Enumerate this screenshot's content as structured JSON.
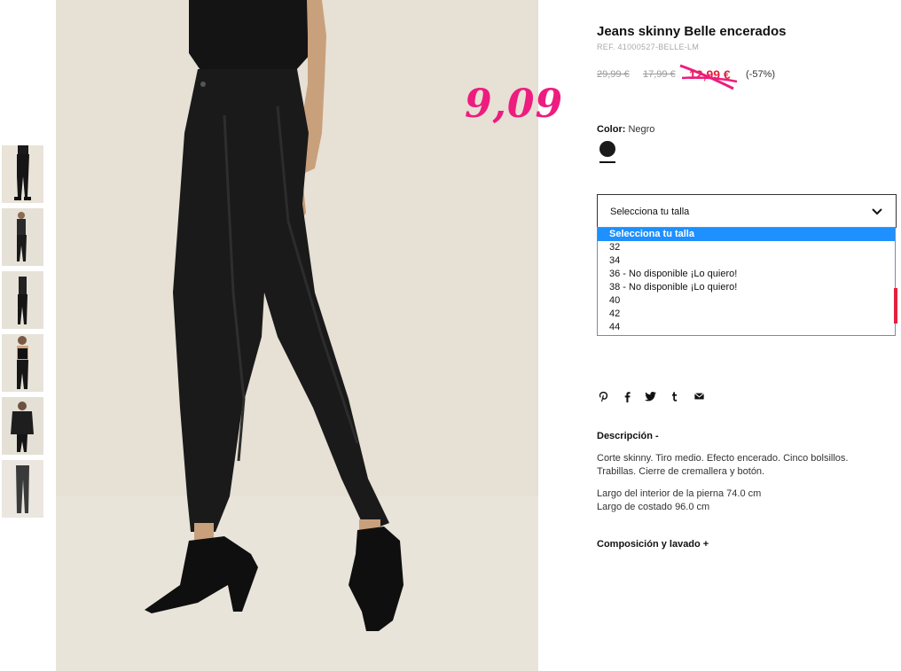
{
  "product": {
    "title": "Jeans skinny Belle encerados",
    "ref": "REF. 41000527-BELLE-LM",
    "prices": {
      "original": "29,99 €",
      "first_markdown": "17,99 €",
      "current": "12,99 €",
      "discount": "(-57%)"
    },
    "overlay_price": "9,09",
    "color": {
      "label": "Color:",
      "value": "Negro",
      "swatch_hex": "#1a1a1a"
    }
  },
  "size_select": {
    "placeholder": "Selecciona tu talla",
    "options": [
      "Selecciona tu talla",
      "32",
      "34",
      "36 - No disponible ¡Lo quiero!",
      "38 - No disponible ¡Lo quiero!",
      "40",
      "42",
      "44"
    ],
    "selected_index": 0
  },
  "share_icons": [
    "pinterest-icon",
    "facebook-icon",
    "twitter-icon",
    "tumblr-icon",
    "email-icon"
  ],
  "description": {
    "heading": "Descripción -",
    "paragraph1": "Corte skinny. Tiro medio. Efecto encerado. Cinco bolsillos. Trabillas. Cierre de cremallera y botón.",
    "paragraph2_line1": "Largo del interior de la pierna 74.0 cm",
    "paragraph2_line2": "Largo de costado 96.0 cm"
  },
  "composition_heading": "Composición y lavado +",
  "colors": {
    "sale_red": "#e4203f",
    "overlay_pink": "#ee1c7e",
    "select_highlight": "#1e90ff"
  }
}
